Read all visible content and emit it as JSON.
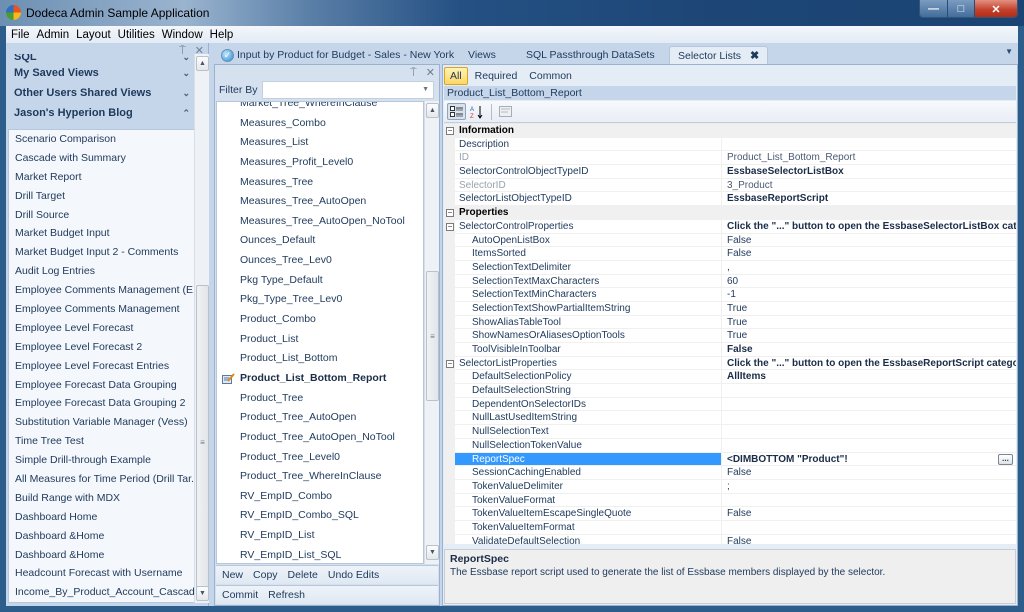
{
  "window": {
    "title": "Dodeca Admin Sample Application",
    "controls": {
      "minimize": "—",
      "maximize": "□",
      "close": "✕"
    }
  },
  "menu": [
    "File",
    "Admin",
    "Layout",
    "Utilities",
    "Window",
    "Help"
  ],
  "left_panel": {
    "pin_icon": "⍑",
    "close_icon": "✕",
    "groups": [
      {
        "label": "SQL",
        "state": "collapsed",
        "chevron": "⌄"
      },
      {
        "label": "My Saved Views",
        "state": "collapsed",
        "chevron": "⌄"
      },
      {
        "label": "Other Users Shared Views",
        "state": "collapsed",
        "chevron": "⌄"
      },
      {
        "label": "Jason's Hyperion Blog",
        "state": "expanded",
        "chevron": "⌃"
      }
    ],
    "items": [
      "Scenario Comparison",
      "Cascade with Summary",
      "Market Report",
      "Drill Target",
      "Drill Source",
      "Market Budget Input",
      "Market Budget Input 2 - Comments",
      "Audit Log Entries",
      "Employee Comments Management (E...",
      "Employee Comments Management",
      "Employee Level Forecast",
      "Employee Level Forecast 2",
      "Employee Level Forecast Entries",
      "Employee Forecast Data Grouping",
      "Employee Forecast Data Grouping 2",
      "Substitution Variable Manager (Vess)",
      "Time Tree Test",
      "Simple Drill-through Example",
      "All Measures for Time Period (Drill Tar...",
      "Build Range with MDX",
      "Dashboard Home",
      "Dashboard &Home",
      "Dashboard &Home",
      "Headcount Forecast with Username",
      "Income_By_Product_Account_Cascade"
    ],
    "scrollbar": {
      "up": "▲",
      "down": "▼",
      "grip": "≡"
    }
  },
  "doc_tabs": {
    "tabs": [
      {
        "label": "Input by Product for Budget - Sales - New York",
        "icon": "check-circle-icon",
        "active": false
      },
      {
        "label": "Views",
        "active": false
      },
      {
        "label": "SQL Passthrough DataSets",
        "active": false
      },
      {
        "label": "Selector Lists",
        "active": true,
        "close": "✖"
      }
    ],
    "overflow_icon": "▼"
  },
  "selector_lists": {
    "pin_icon": "⍑",
    "close_icon": "✕",
    "filter_label": "Filter By",
    "filter_value": "",
    "filter_dropdown": "▼",
    "items": [
      {
        "label": "Market_Tree_WhereInClause"
      },
      {
        "label": "Measures_Combo"
      },
      {
        "label": "Measures_List"
      },
      {
        "label": "Measures_Profit_Level0"
      },
      {
        "label": "Measures_Tree"
      },
      {
        "label": "Measures_Tree_AutoOpen"
      },
      {
        "label": "Measures_Tree_AutoOpen_NoTool"
      },
      {
        "label": "Ounces_Default"
      },
      {
        "label": "Ounces_Tree_Lev0"
      },
      {
        "label": "Pkg Type_Default"
      },
      {
        "label": "Pkg_Type_Tree_Lev0"
      },
      {
        "label": "Product_Combo"
      },
      {
        "label": "Product_List"
      },
      {
        "label": "Product_List_Bottom"
      },
      {
        "label": "Product_List_Bottom_Report",
        "active": true,
        "edited": true
      },
      {
        "label": "Product_Tree"
      },
      {
        "label": "Product_Tree_AutoOpen"
      },
      {
        "label": "Product_Tree_AutoOpen_NoTool"
      },
      {
        "label": "Product_Tree_Level0"
      },
      {
        "label": "Product_Tree_WhereInClause"
      },
      {
        "label": "RV_EmpID_Combo"
      },
      {
        "label": "RV_EmpID_Combo_SQL"
      },
      {
        "label": "RV_EmpID_List"
      },
      {
        "label": "RV_EmpID_List_SQL"
      }
    ],
    "actions_row1": [
      "New",
      "Copy",
      "Delete",
      "Undo Edits"
    ],
    "actions_row2": [
      "Commit",
      "Refresh"
    ]
  },
  "property_grid": {
    "filter_tabs": [
      {
        "label": "All",
        "active": true
      },
      {
        "label": "Required",
        "active": false
      },
      {
        "label": "Common",
        "active": false
      }
    ],
    "object_title": "Product_List_Bottom_Report",
    "toolbar": {
      "categorized": "categorized-view",
      "alphabetical": "A↓Z",
      "property_pages": "property-pages"
    },
    "rows": [
      {
        "type": "cat",
        "name": "Information",
        "value": ""
      },
      {
        "type": "sub",
        "name": "Description",
        "value": ""
      },
      {
        "type": "sub",
        "name": "ID",
        "value": "Product_List_Bottom_Report",
        "dim": true
      },
      {
        "type": "sub",
        "name": "SelectorControlObjectTypeID",
        "value": "EssbaseSelectorListBox",
        "bold": true
      },
      {
        "type": "sub",
        "name": "SelectorID",
        "value": "3_Product",
        "dim": true
      },
      {
        "type": "sub",
        "name": "SelectorListObjectTypeID",
        "value": "EssbaseReportScript",
        "bold": true
      },
      {
        "type": "cat",
        "name": "Properties",
        "value": ""
      },
      {
        "type": "group",
        "name": "SelectorControlProperties",
        "value": "Click the \"...\" button to open the EssbaseSelectorListBox category editor.",
        "bold": true
      },
      {
        "type": "child",
        "name": "AutoOpenListBox",
        "value": "False"
      },
      {
        "type": "child",
        "name": "ItemsSorted",
        "value": "False"
      },
      {
        "type": "child",
        "name": "SelectionTextDelimiter",
        "value": ","
      },
      {
        "type": "child",
        "name": "SelectionTextMaxCharacters",
        "value": "60"
      },
      {
        "type": "child",
        "name": "SelectionTextMinCharacters",
        "value": "-1"
      },
      {
        "type": "child",
        "name": "SelectionTextShowPartialItemString",
        "value": "True"
      },
      {
        "type": "child",
        "name": "ShowAliasTableTool",
        "value": "True"
      },
      {
        "type": "child",
        "name": "ShowNamesOrAliasesOptionTools",
        "value": "True"
      },
      {
        "type": "child",
        "name": "ToolVisibleInToolbar",
        "value": "False",
        "bold": true
      },
      {
        "type": "group",
        "name": "SelectorListProperties",
        "value": "Click the \"...\" button to open the EssbaseReportScript category editor.",
        "bold": true
      },
      {
        "type": "child",
        "name": "DefaultSelectionPolicy",
        "value": "AllItems",
        "bold": true
      },
      {
        "type": "child",
        "name": "DefaultSelectionString",
        "value": ""
      },
      {
        "type": "child",
        "name": "DependentOnSelectorIDs",
        "value": ""
      },
      {
        "type": "child",
        "name": "NullLastUsedItemString",
        "value": ""
      },
      {
        "type": "child",
        "name": "NullSelectionText",
        "value": ""
      },
      {
        "type": "child",
        "name": "NullSelectionTokenValue",
        "value": ""
      },
      {
        "type": "child",
        "name": "ReportSpec",
        "value": "<DIMBOTTOM \"Product\"!",
        "bold": true,
        "selected": true,
        "ellipsis": "..."
      },
      {
        "type": "child",
        "name": "SessionCachingEnabled",
        "value": "False"
      },
      {
        "type": "child",
        "name": "TokenValueDelimiter",
        "value": ";"
      },
      {
        "type": "child",
        "name": "TokenValueFormat",
        "value": ""
      },
      {
        "type": "child",
        "name": "TokenValueItemEscapeSingleQuote",
        "value": "False"
      },
      {
        "type": "child",
        "name": "TokenValueItemFormat",
        "value": ""
      },
      {
        "type": "child",
        "name": "ValidateDefaultSelection",
        "value": "False"
      }
    ],
    "help": {
      "title": "ReportSpec",
      "description": "The Essbase report script used to generate the list of Essbase members displayed by the selector."
    }
  }
}
